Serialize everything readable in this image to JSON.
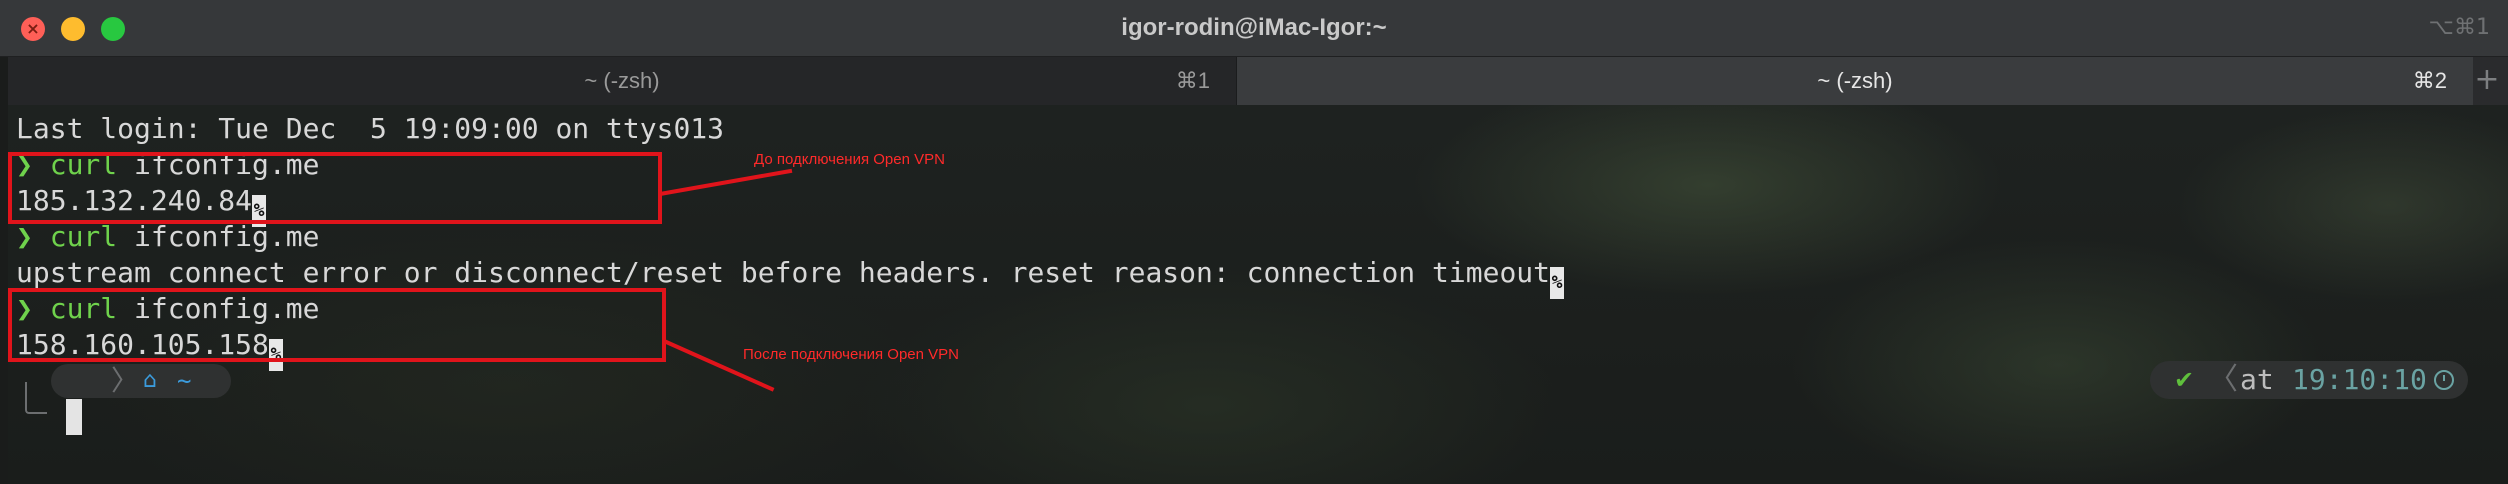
{
  "window": {
    "title": "igor-rodin@iMac-Igor:~",
    "shortcut": "⌥⌘1",
    "close_glyph": "×"
  },
  "tabs": [
    {
      "label": "~ (-zsh)",
      "shortcut": "⌘1",
      "active": false
    },
    {
      "label": "~ (-zsh)",
      "shortcut": "⌘2",
      "active": true
    }
  ],
  "new_tab_label": "+",
  "terminal": {
    "last_login": "Last login: Tue Dec  5 19:09:00 on ttys013",
    "prompt_symbol": "❯",
    "eol_marker": "%",
    "blocks": [
      {
        "command_word": "curl",
        "command_args": " ifconfig.me",
        "output": "185.132.240.84"
      },
      {
        "command_word": "curl",
        "command_args": " ifconfig.me",
        "output": "upstream connect error or disconnect/reset before headers. reset reason: connection timeout"
      },
      {
        "command_word": "curl",
        "command_args": " ifconfig.me",
        "output": "158.160.105.158"
      }
    ]
  },
  "annotations": {
    "before": "До подключения Open VPN",
    "after": "После подключения Open VPN",
    "color": "#e0141b"
  },
  "prompt": {
    "apple_icon": "",
    "separator": "〉",
    "home_icon": "⌂",
    "path": "~",
    "status_icon": "✔",
    "right_separator": "〈",
    "at_label": "at",
    "time": "19:10:10"
  }
}
